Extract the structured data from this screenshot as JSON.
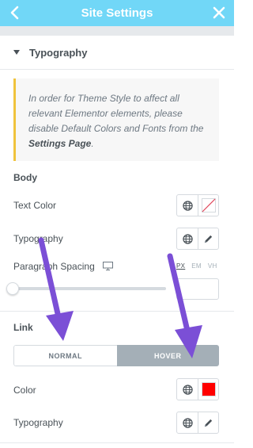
{
  "header": {
    "title": "Site Settings",
    "back_icon": "chevron-left-icon",
    "close_icon": "close-icon",
    "background": "#71d7f7"
  },
  "section": {
    "label": "Typography",
    "expanded": true
  },
  "notice": {
    "text": "In order for Theme Style to affect all relevant Elementor elements, please disable Default Colors and Fonts from the",
    "link_text": "Settings Page",
    "suffix": "."
  },
  "body_group": {
    "title": "Body",
    "text_color_label": "Text Color",
    "typography_label": "Typography",
    "paragraph_spacing_label": "Paragraph Spacing",
    "units": [
      "PX",
      "EM",
      "VH"
    ],
    "active_unit": "PX",
    "spacing_value": ""
  },
  "link_group": {
    "title": "Link",
    "tabs": [
      "NORMAL",
      "HOVER"
    ],
    "active_tab": "HOVER",
    "color_label": "Color",
    "color_value": "#ff0000",
    "typography_label": "Typography"
  },
  "colors": {
    "accent": "#71d7f7",
    "notice_border": "#f0c33c",
    "annotation_arrow": "#7b4fd6"
  }
}
